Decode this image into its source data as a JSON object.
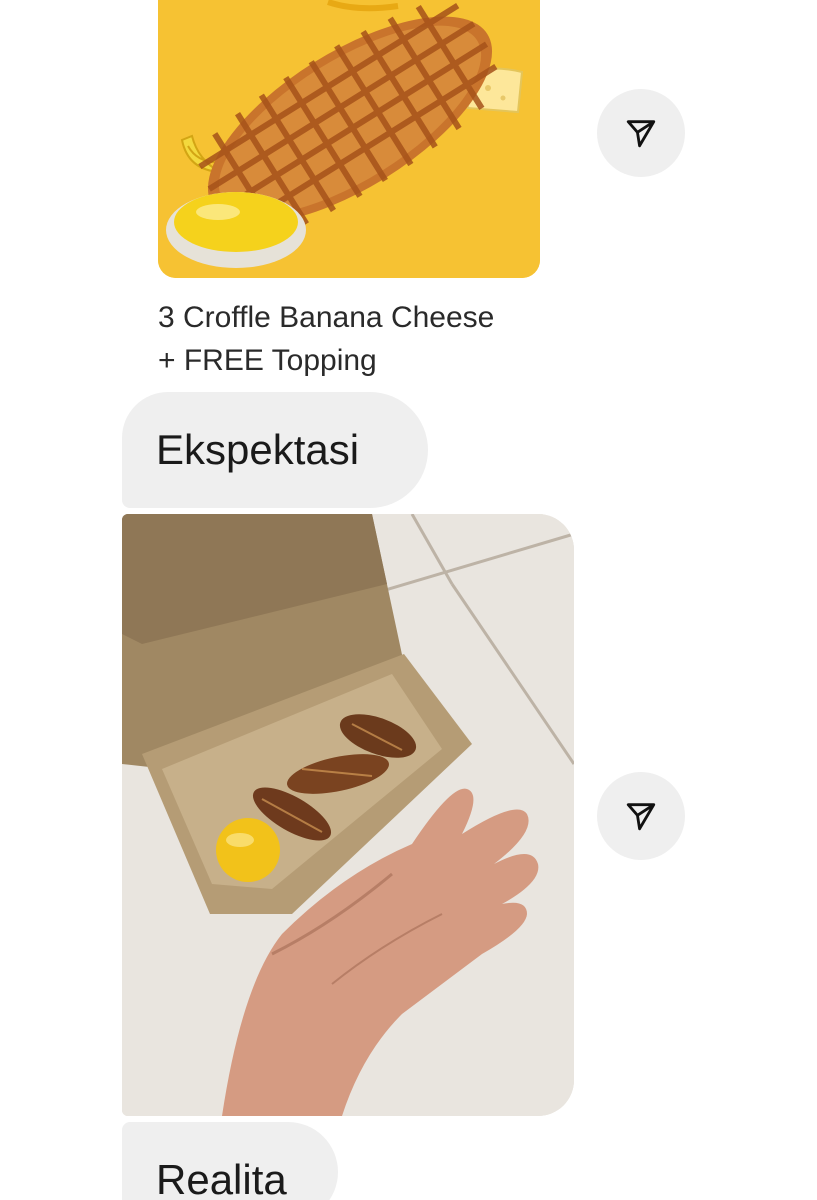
{
  "messages": {
    "promo": {
      "image_icon": "croffle-promo-image",
      "caption_line_1": "3 Croffle Banana Cheese",
      "caption_line_2": "+ FREE Topping"
    },
    "bubble_1": {
      "text": "Ekspektasi"
    },
    "reality": {
      "image_icon": "croffle-box-photo"
    },
    "bubble_2": {
      "text": "Realita"
    }
  },
  "share": {
    "icon": "send-icon",
    "label": "Share"
  },
  "colors": {
    "bubble": "#efefef",
    "promo_background": "#f6c233",
    "share_button": "#efefef"
  }
}
